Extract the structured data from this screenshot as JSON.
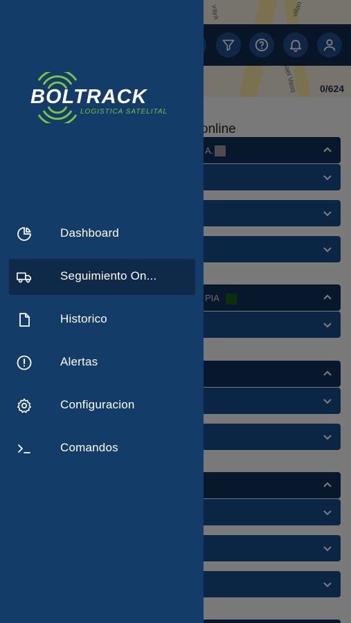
{
  "brand": {
    "name": "BOLTRACK",
    "tagline": "LOGISTICA SATELITAL",
    "accent": "#7cc242"
  },
  "menu": {
    "items": [
      {
        "label": "Dashboard",
        "icon": "pie-chart-icon"
      },
      {
        "label": "Seguimiento On...",
        "icon": "truck-icon",
        "active": true
      },
      {
        "label": "Historico",
        "icon": "document-icon"
      },
      {
        "label": "Alertas",
        "icon": "alert-circle-icon"
      },
      {
        "label": "Configuracion",
        "icon": "gear-icon"
      },
      {
        "label": "Comandos",
        "icon": "terminal-icon"
      }
    ]
  },
  "background": {
    "count": "0/624",
    "heading": "online",
    "group1_text": "A.",
    "group2_text": "PIA",
    "road_labels": [
      "vaya",
      "villan",
      "fael Vasq"
    ],
    "toolbar_icons": [
      "filter-icon",
      "help-icon",
      "bell-icon",
      "user-icon"
    ]
  },
  "colors": {
    "drawer_bg": "#133c68",
    "active_item_bg": "#0f2a48",
    "panel_bg": "#164b8a"
  }
}
